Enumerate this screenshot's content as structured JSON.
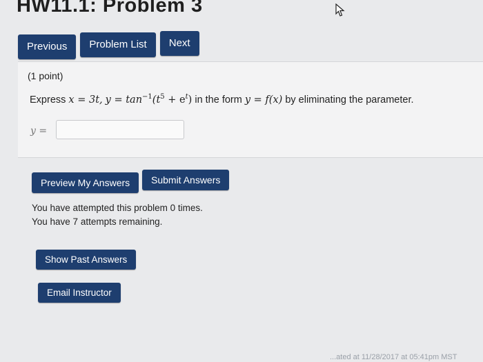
{
  "header": {
    "title": "HW11.1: Problem 3"
  },
  "nav": {
    "previous_label": "Previous",
    "problem_list_label": "Problem List",
    "next_label": "Next"
  },
  "problem": {
    "points": "(1 point)",
    "text_prefix": "Express",
    "text_mid": "in the form",
    "text_suffix": "by eliminating the parameter.",
    "math_x": "x = 3t,",
    "math_y": "y = tan",
    "math_inv": "−1",
    "math_arg_open": "(t",
    "math_pow": "5",
    "math_plus": " + e",
    "math_exp": "t",
    "math_close": ")",
    "math_form": "y = f(x)",
    "answer_label": "y =",
    "answer_value": ""
  },
  "actions": {
    "preview_label": "Preview My Answers",
    "submit_label": "Submit Answers"
  },
  "status": {
    "attempted": "You have attempted this problem 0 times.",
    "remaining": "You have 7 attempts remaining."
  },
  "extra": {
    "show_past_label": "Show Past Answers",
    "email_label": "Email Instructor"
  },
  "footer": {
    "text": "...ated at 11/28/2017 at 05:41pm MST"
  },
  "colors": {
    "button_bg": "#1e3e6f",
    "page_bg": "#e9eaec"
  }
}
